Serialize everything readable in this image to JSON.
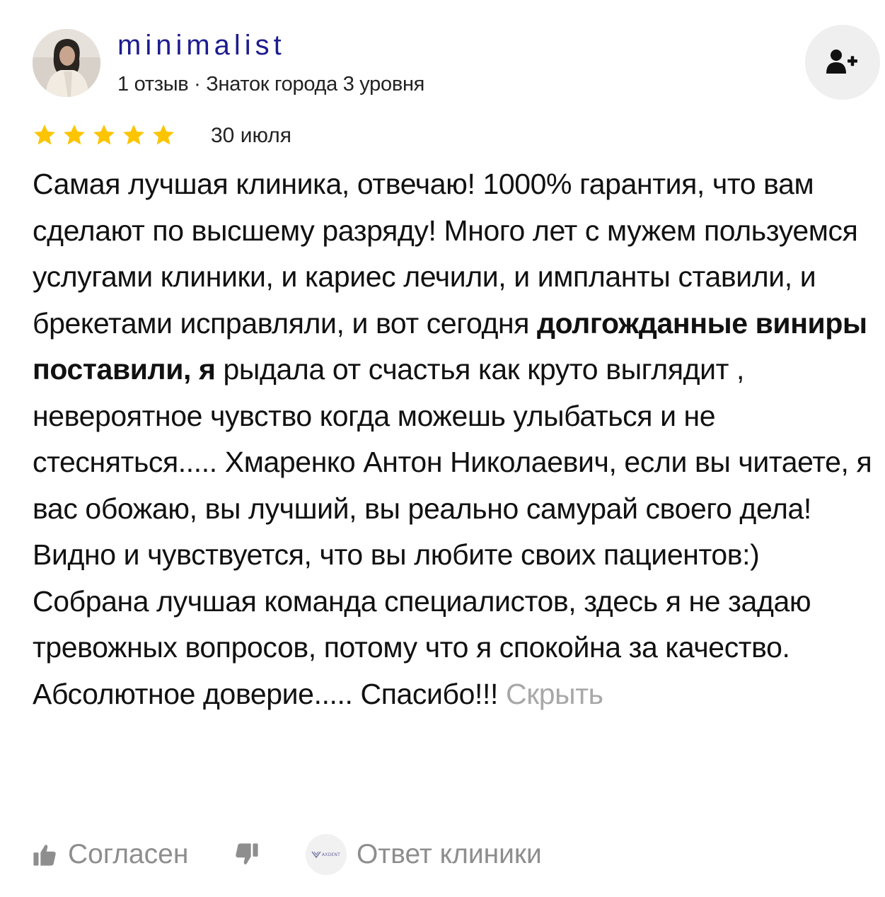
{
  "author": {
    "name": "minimalist",
    "meta": "1 отзыв · Знаток города 3 уровня"
  },
  "rating": {
    "stars": 5,
    "max": 5,
    "star_color": "#fcc500"
  },
  "date": "30 июля",
  "text": {
    "part1": "Самая лучшая клиника, отвечаю! 1000% гарантия, что вам сделают по высшему разряду! Много лет с мужем пользуемся услугами клиники, и кариес лечили, и импланты ставили, и брекетами исправляли, и вот сегодня ",
    "bold": "долгожданные виниры поставили, я",
    "part2": " рыдала от счастья как круто выглядит , невероятное чувство когда можешь улыбаться и не стесняться..... Хмаренко Антон Николаевич, если вы читаете, я вас обожаю, вы лучший, вы реально самурай своего дела! Видно и чувствуется, что вы любите своих пациентов:) Собрана лучшая команда специалистов, здесь я не задаю тревожных вопросов, потому что я спокойна за качество. Абсолютное доверие..... Спасибо!!! ",
    "hide_label": "Скрыть"
  },
  "footer": {
    "agree_label": "Согласен",
    "clinic_reply_label": "Ответ клиники",
    "clinic_logo_text": "AXDENT"
  },
  "icons": {
    "subscribe": "add-user-icon",
    "agree": "thumbs-up-icon",
    "dislike": "thumbs-down-icon"
  },
  "colors": {
    "author_name": "#1c1c8f",
    "muted_text": "#8e8e8e",
    "hide_link": "#a8a8a8",
    "button_bg": "#efefef"
  }
}
